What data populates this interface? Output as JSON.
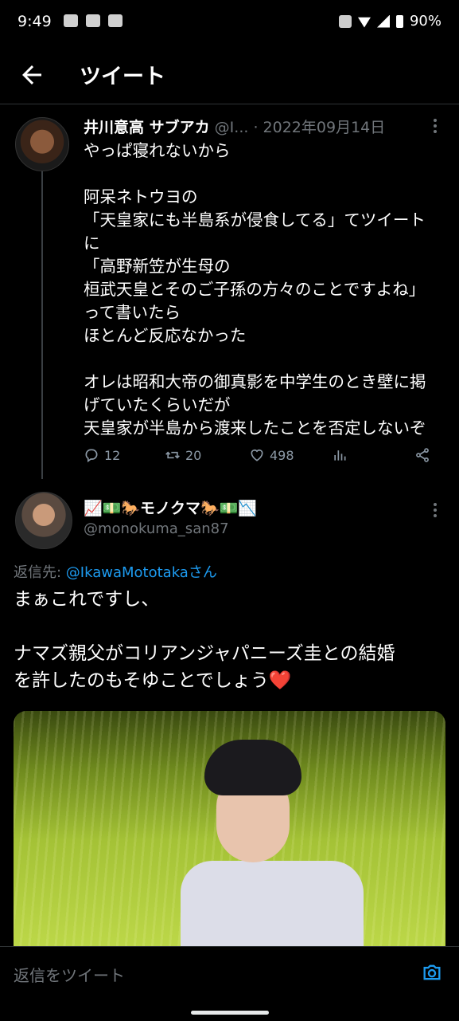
{
  "status_bar": {
    "time": "9:49",
    "battery": "90%"
  },
  "header": {
    "title": "ツイート"
  },
  "tweet1": {
    "name": "井川意高 サブアカ",
    "handle": "@I...",
    "date": "· 2022年09月14日",
    "body": "やっぱ寝れないから\n\n阿呆ネトウヨの\n「天皇家にも半島系が侵食してる」てツイート\nに\n「高野新笠が生母の\n桓武天皇とそのご子孫の方々のことですよね」\nって書いたら\nほとんど反応なかった\n\nオレは昭和大帝の御真影を中学生のとき壁に掲\nげていたくらいだが\n天皇家が半島から渡来したことを否定しないぞ",
    "replies": "12",
    "retweets": "20",
    "likes": "498"
  },
  "tweet2": {
    "name": "📈💵🐎モノクマ🐎💵📉",
    "handle": "@monokuma_san87",
    "reply_prefix": "返信先: ",
    "reply_link": "@IkawaMototakaさん",
    "body": "まぁこれですし、\n\nナマズ親父がコリアンジャパニーズ圭との結婚\nを許したのもそゆことでしょう",
    "heart": "❤️"
  },
  "compose": {
    "placeholder": "返信をツイート"
  },
  "colors": {
    "accent": "#1d9bf0",
    "background": "#000000",
    "muted": "#71767b",
    "heart": "#f4212e"
  }
}
